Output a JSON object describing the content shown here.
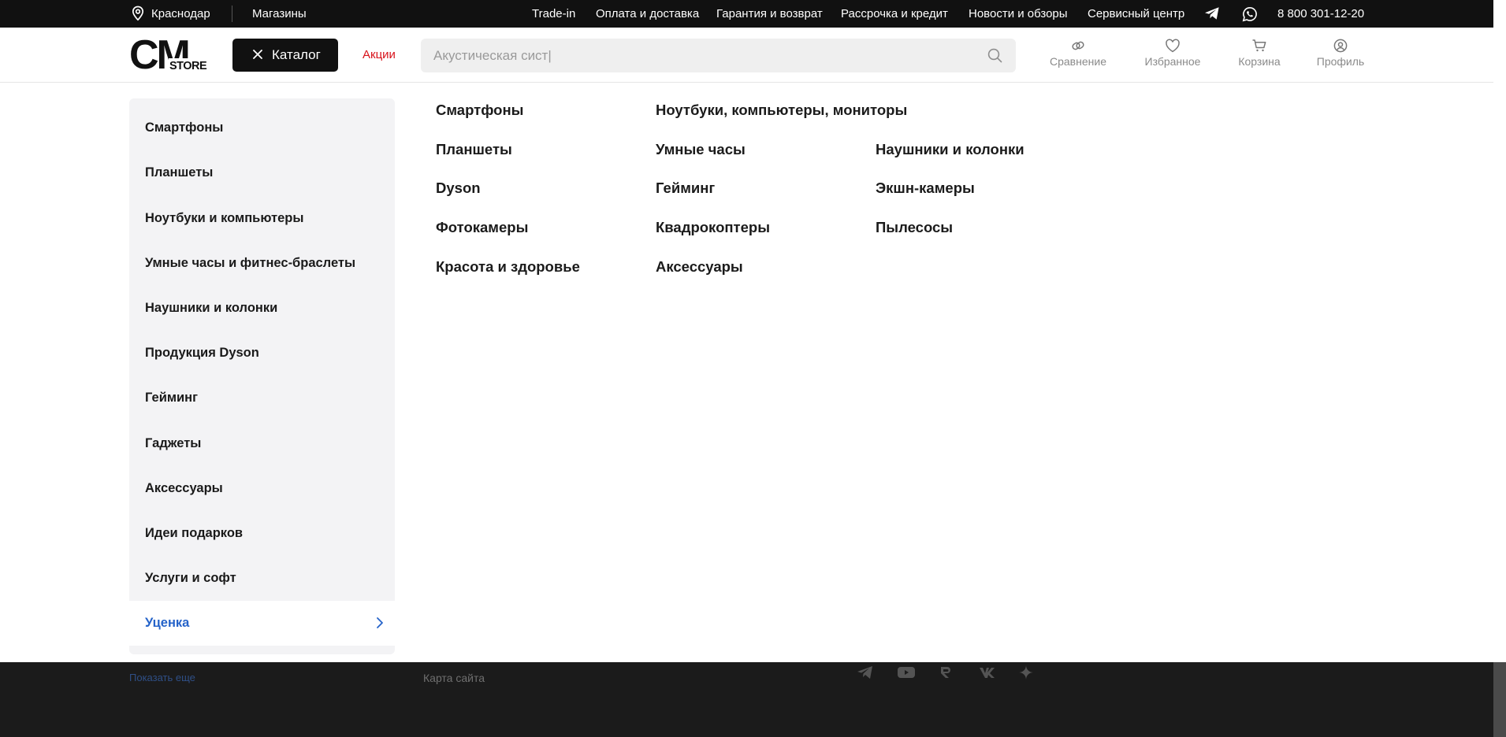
{
  "topbar": {
    "city": "Краснодар",
    "stores": "Магазины",
    "links": [
      "Trade-in",
      "Оплата и доставка",
      "Гарантия и возврат",
      "Рассрочка и кредит",
      "Новости и обзоры",
      "Сервисный центр"
    ],
    "phone": "8 800 301-12-20"
  },
  "header": {
    "logo_text": "CM STORE",
    "catalog_label": "Каталог",
    "promo_label": "Акции",
    "search_placeholder": "Акустическая сист|",
    "actions": {
      "compare": "Сравнение",
      "favorites": "Избранное",
      "cart": "Корзина",
      "profile": "Профиль"
    }
  },
  "sidebar": {
    "items": [
      "Смартфоны",
      "Планшеты",
      "Ноутбуки и компьютеры",
      "Умные часы и фитнес-браслеты",
      "Наушники и колонки",
      "Продукция Dyson",
      "Гейминг",
      "Гаджеты",
      "Аксессуары",
      "Идеи подарков",
      "Услуги и софт",
      "Уценка"
    ],
    "active_index": 11
  },
  "subcategories": {
    "col1": [
      "Смартфоны",
      "Планшеты",
      "Dyson",
      "Фотокамеры",
      "Красота и здоровье"
    ],
    "col2": [
      "Ноутбуки, компьютеры, мониторы",
      "Умные часы",
      "Гейминг",
      "Квадрокоптеры",
      "Аксессуары"
    ],
    "col3": [
      "Наушники и колонки",
      "Экшн-камеры",
      "Пылесосы"
    ]
  },
  "footer": {
    "show_more": "Показать еще",
    "sitemap": "Карта сайта"
  },
  "colors": {
    "topbar_bg": "#111111",
    "accent_red": "#d8121a",
    "active_blue": "#2563c9",
    "sidebar_bg": "#f3f3f5"
  }
}
